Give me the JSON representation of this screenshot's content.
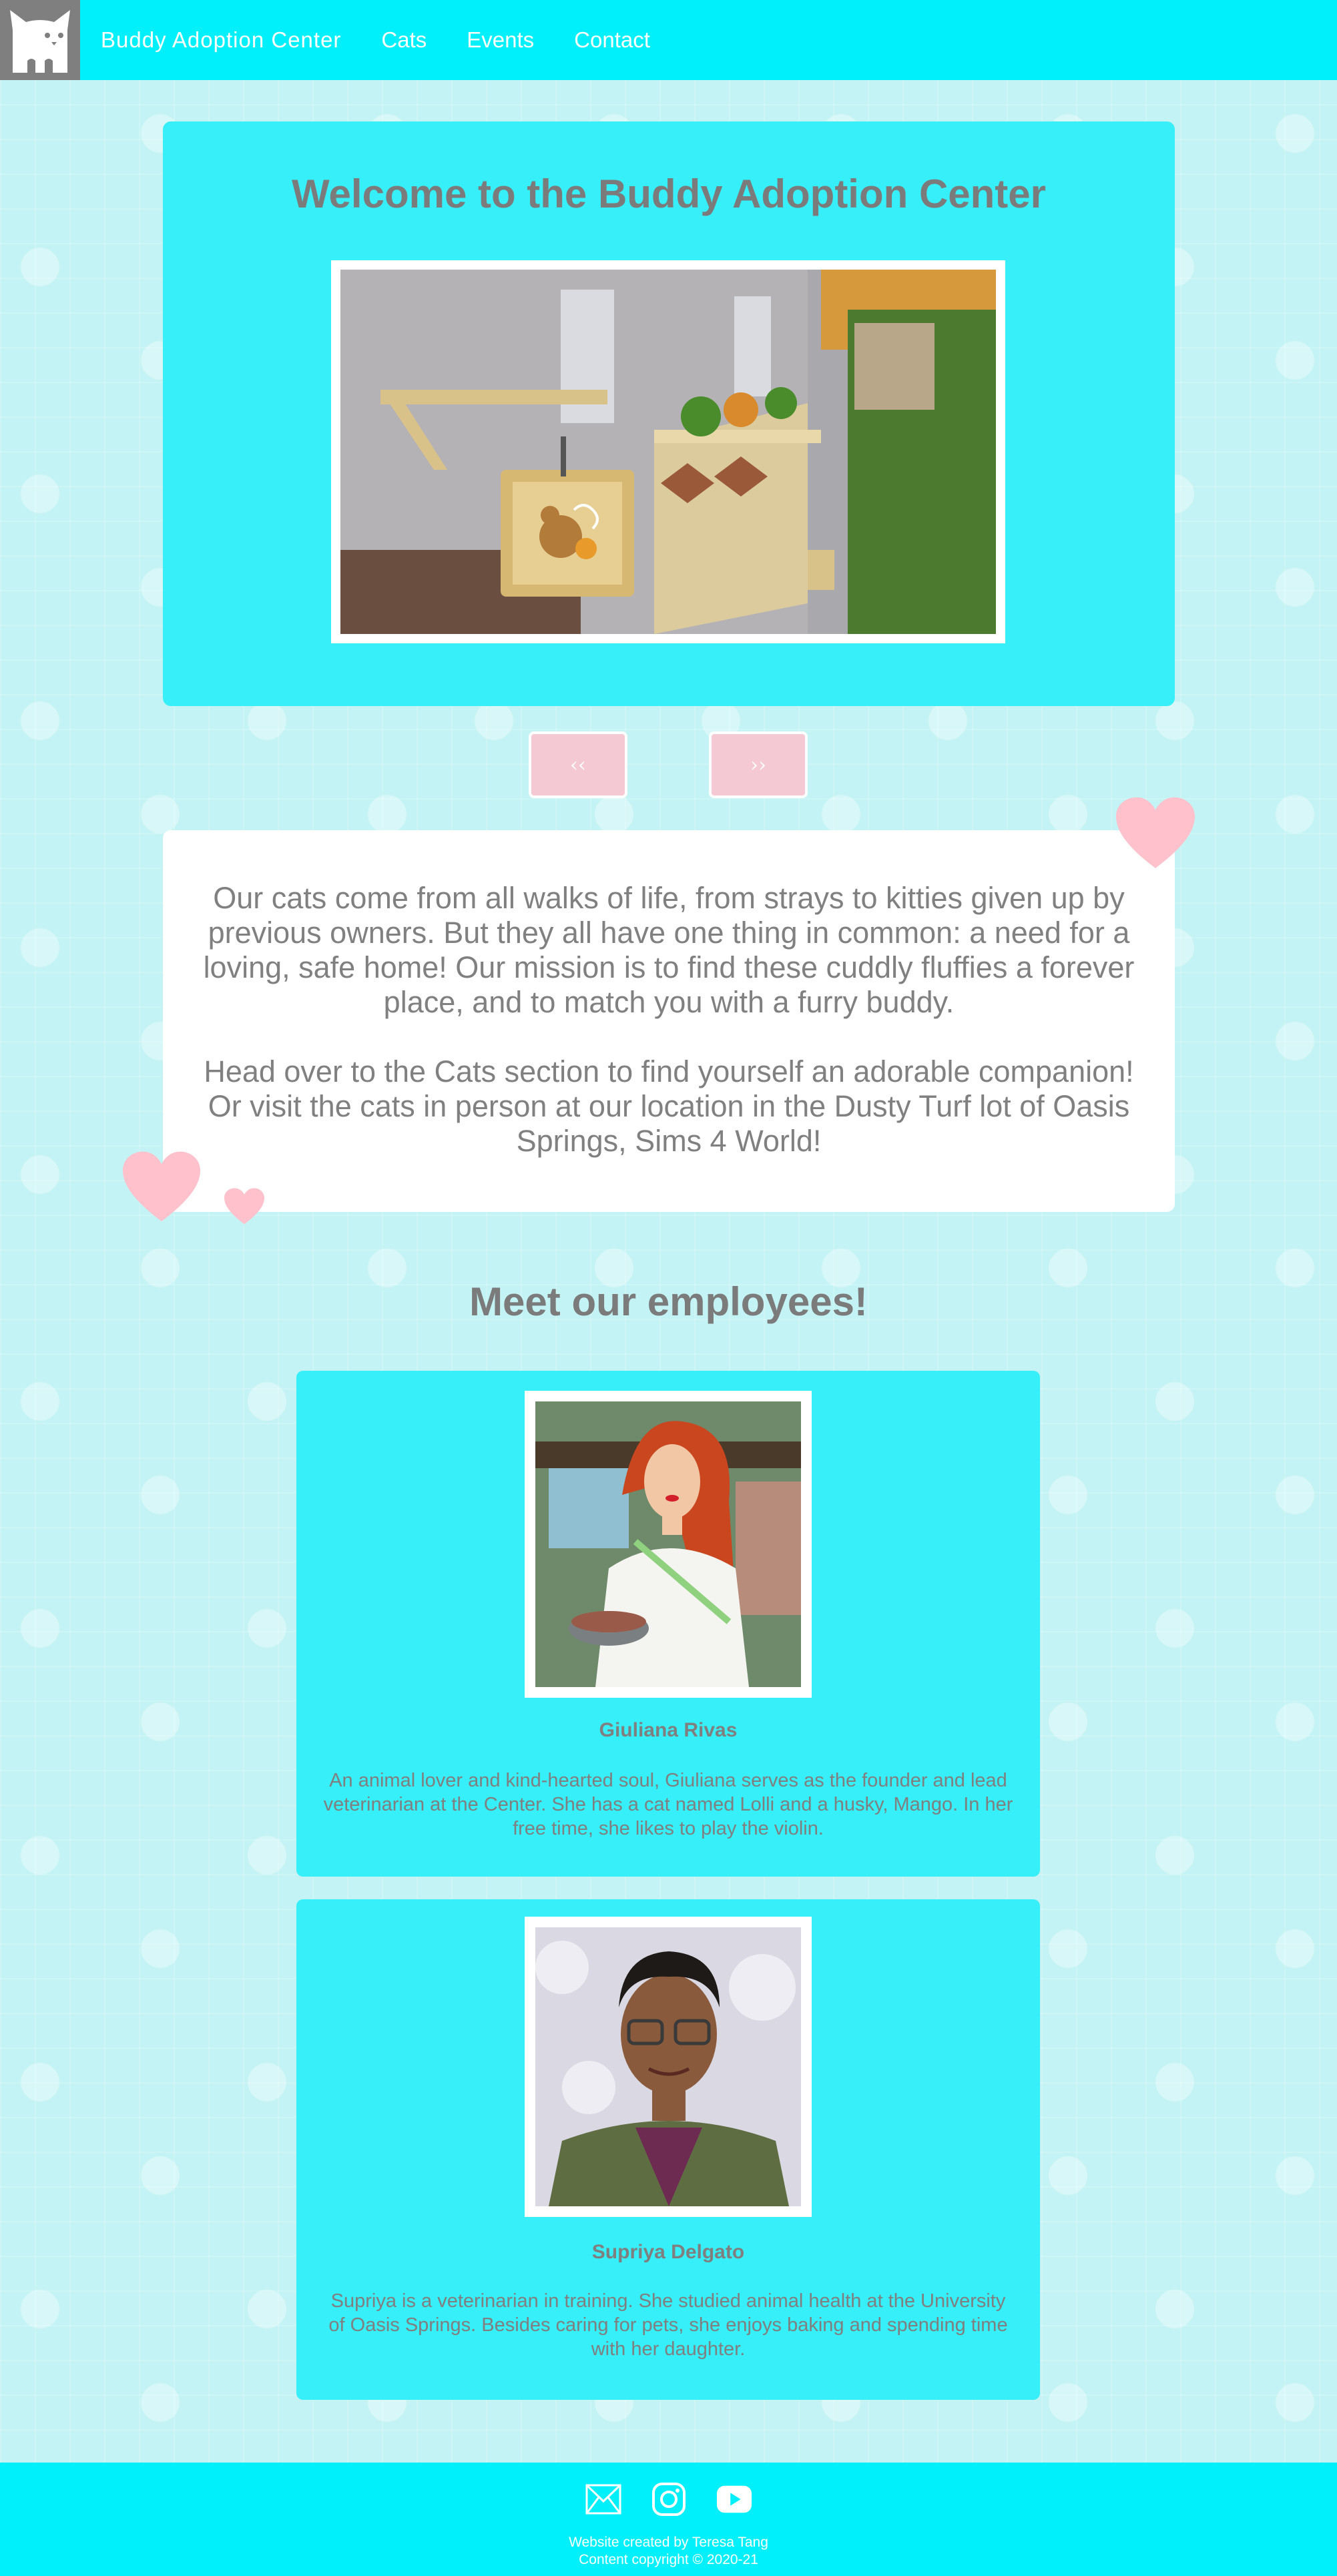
{
  "nav": {
    "logo_icon": "cat-logo-icon",
    "brand": "Buddy Adoption Center",
    "links": [
      "Cats",
      "Events",
      "Contact"
    ]
  },
  "hero": {
    "title": "Welcome to the Buddy Adoption Center"
  },
  "slider": {
    "prev_label": "‹‹",
    "next_label": "››"
  },
  "mission": {
    "paragraph1": "Our cats come from all walks of life, from strays to kitties given up by previous owners. But they all have one thing in common: a need for a loving, safe home! Our mission is to find these cuddly fluffies a forever place, and to match you with a furry buddy.",
    "paragraph2": "Head over to the Cats section to find yourself an adorable companion! Or visit the cats in person at our location in the Dusty Turf lot of Oasis Springs, Sims 4 World!"
  },
  "employees": {
    "heading": "Meet our employees!",
    "people": [
      {
        "name": "Giuliana Rivas",
        "bio": "An animal lover and kind-hearted soul, Giuliana serves as the founder and lead veterinarian at the Center. She has a cat named Lolli and a husky, Mango. In her free time, she likes to play the violin."
      },
      {
        "name": "Supriya Delgato",
        "bio": "Supriya is a veterinarian in training. She studied animal health at the University of Oasis Springs. Besides caring for pets, she enjoys baking and spending time with her daughter."
      }
    ]
  },
  "footer": {
    "icons": [
      "mail-icon",
      "instagram-icon",
      "youtube-icon"
    ],
    "credit": "Website created by Teresa Tang",
    "copyright": "Content copyright © 2020-21"
  },
  "colors": {
    "nav": "#00f0fb",
    "card": "#37eff8",
    "background": "#c3f3f4",
    "text": "#808080",
    "heart": "#ffc1cc",
    "button": "#f5c9d3"
  }
}
